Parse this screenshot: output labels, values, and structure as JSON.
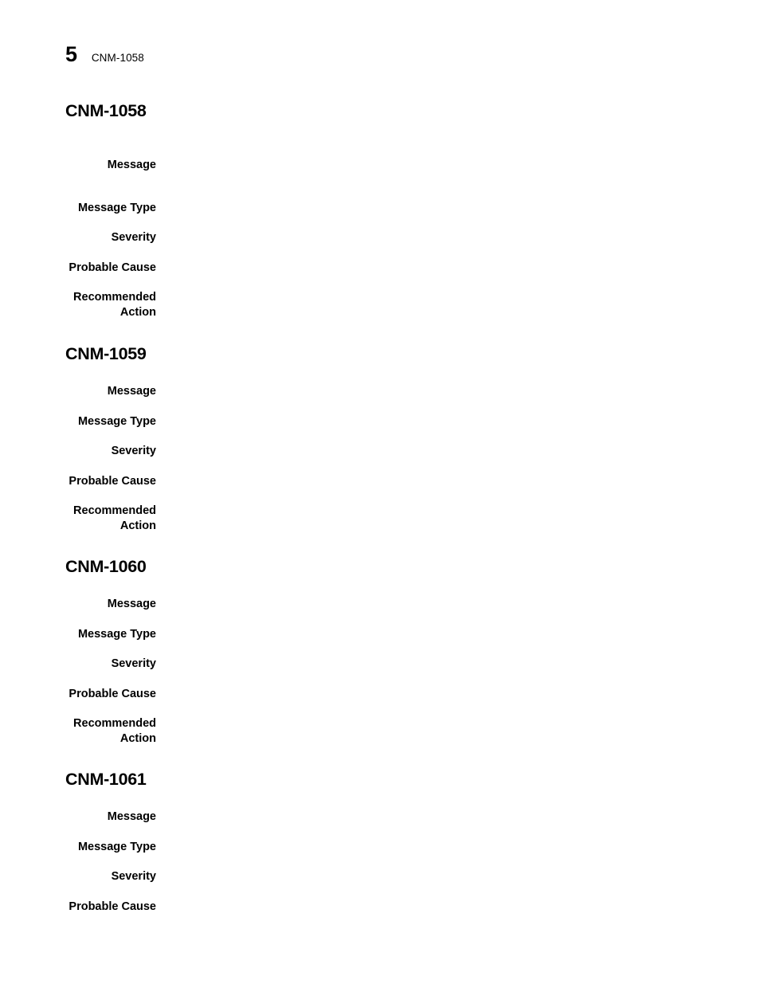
{
  "header": {
    "chapter_number": "5",
    "running_head": "CNM-1058"
  },
  "field_labels": {
    "message": "Message",
    "message_type": "Message Type",
    "severity": "Severity",
    "probable_cause": "Probable Cause",
    "recommended_action": "Recommended\nAction"
  },
  "sections": [
    {
      "heading": "CNM-1058",
      "fields": [
        {
          "label": "Message",
          "value": ""
        },
        {
          "label": "Message Type",
          "value": ""
        },
        {
          "label": "Severity",
          "value": ""
        },
        {
          "label": "Probable Cause",
          "value": ""
        },
        {
          "label": "Recommended\nAction",
          "value": ""
        }
      ]
    },
    {
      "heading": "CNM-1059",
      "fields": [
        {
          "label": "Message",
          "value": ""
        },
        {
          "label": "Message Type",
          "value": ""
        },
        {
          "label": "Severity",
          "value": ""
        },
        {
          "label": "Probable Cause",
          "value": ""
        },
        {
          "label": "Recommended\nAction",
          "value": ""
        }
      ]
    },
    {
      "heading": "CNM-1060",
      "fields": [
        {
          "label": "Message",
          "value": ""
        },
        {
          "label": "Message Type",
          "value": ""
        },
        {
          "label": "Severity",
          "value": ""
        },
        {
          "label": "Probable Cause",
          "value": ""
        },
        {
          "label": "Recommended\nAction",
          "value": ""
        }
      ]
    },
    {
      "heading": "CNM-1061",
      "fields": [
        {
          "label": "Message",
          "value": ""
        },
        {
          "label": "Message Type",
          "value": ""
        },
        {
          "label": "Severity",
          "value": ""
        },
        {
          "label": "Probable Cause",
          "value": ""
        }
      ]
    }
  ]
}
